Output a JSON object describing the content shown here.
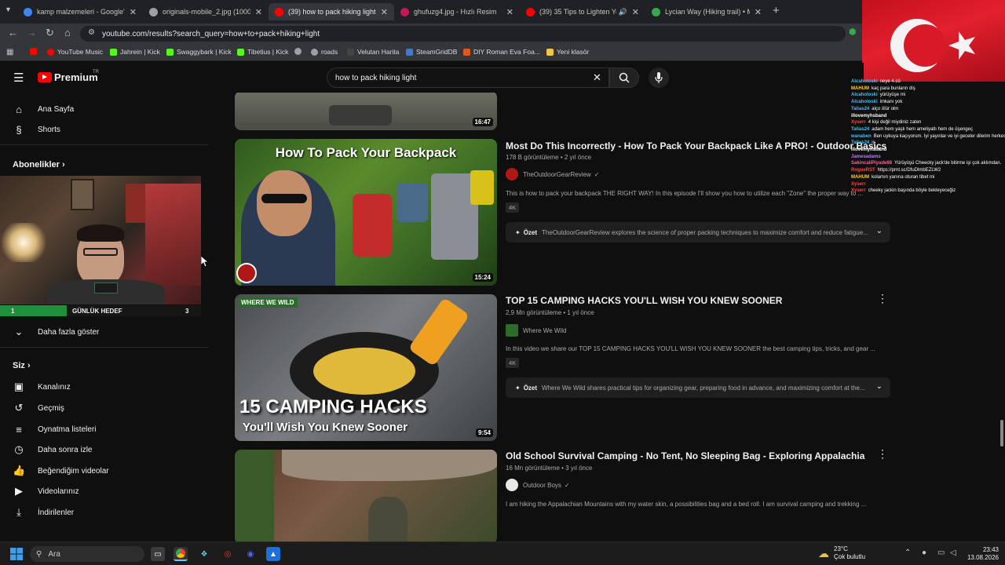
{
  "browser": {
    "tabs": [
      {
        "title": "kamp malzemeleri - Google'da",
        "icon": "google-icon",
        "color": "#4285f4"
      },
      {
        "title": "originals-mobile_2.jpg (1000×1",
        "icon": "globe-icon",
        "color": "#9aa0a6"
      },
      {
        "title": "(39) how to pack hiking light -",
        "icon": "youtube-icon",
        "color": "#ff0000"
      },
      {
        "title": "ghufuzg4.jpg - Hızlı Resim",
        "icon": "image-icon",
        "color": "#c2185b"
      },
      {
        "title": "(39) 35 Tips to Lighten Your",
        "icon": "youtube-icon",
        "color": "#ff0000"
      },
      {
        "title": "Lycian Way (Hiking trail) • Map",
        "icon": "map-icon",
        "color": "#34a853"
      }
    ],
    "url": "youtube.com/results?search_query=how+to+pack+hiking+light",
    "bookmarks": [
      {
        "label": "",
        "color": "#ff0000"
      },
      {
        "label": "YouTube Music",
        "color": "#ff0000"
      },
      {
        "label": "Jahrein | Kick",
        "color": "#53fc18"
      },
      {
        "label": "Swaggybark | Kick",
        "color": "#53fc18"
      },
      {
        "label": "Tibetius | Kick",
        "color": "#53fc18"
      },
      {
        "label": "",
        "color": "#9aa0a6"
      },
      {
        "label": "roads",
        "color": "#9aa0a6"
      },
      {
        "label": "Velutan Harita",
        "color": "#444"
      },
      {
        "label": "SteamGridDB",
        "color": "#3b7bd4"
      },
      {
        "label": "DIY Roman Eva Foa...",
        "color": "#e8551b"
      },
      {
        "label": "Yeni klasör",
        "color": "#f4c542"
      }
    ]
  },
  "youtube": {
    "logo_text": "Premium",
    "logo_sup": "TR",
    "search_value": "how to pack hiking light"
  },
  "sidebar": {
    "top": [
      {
        "label": "Ana Sayfa",
        "icon": "home-icon"
      },
      {
        "label": "Shorts",
        "icon": "shorts-icon"
      }
    ],
    "subs_header": "Abonelikler",
    "goal_left": "1",
    "goal_label": "GÜNLÜK HEDEF",
    "goal_right": "3",
    "show_more": "Daha fazla göster",
    "you_header": "Siz",
    "you_items": [
      {
        "label": "Kanalınız",
        "icon": "channel-icon"
      },
      {
        "label": "Geçmiş",
        "icon": "history-icon"
      },
      {
        "label": "Oynatma listeleri",
        "icon": "playlists-icon"
      },
      {
        "label": "Daha sonra izle",
        "icon": "watch-later-icon"
      },
      {
        "label": "Beğendiğim videolar",
        "icon": "liked-icon"
      },
      {
        "label": "Videolarınız",
        "icon": "your-videos-icon"
      },
      {
        "label": "İndirilenler",
        "icon": "downloads-icon"
      }
    ]
  },
  "results": {
    "prev_duration": "16:47",
    "videos": [
      {
        "title": "Most Do This Incorrectly - How To Pack Your Backpack Like A PRO! - Outdoor Basics",
        "meta": "178 B görüntüleme • 2 yıl önce",
        "channel": "TheOutdoorGearReview",
        "desc": "This is how to pack your backpack THE RIGHT WAY! In this episode I'll show you how to utilize each \"Zone\" the proper way to ...",
        "badge": "4K",
        "summary_label": "Özet",
        "summary": "TheOutdoorGearReview explores the science of proper packing techniques to maximize comfort and reduce fatigue...",
        "duration": "15:24",
        "thumb_text": "How To Pack Your Backpack"
      },
      {
        "title": "TOP 15 CAMPING HACKS YOU'LL WISH YOU KNEW SOONER",
        "meta": "2,9 Mn görüntüleme • 1 yıl önce",
        "channel": "Where We Wild",
        "desc": "In this video we share our TOP 15 CAMPING HACKS YOU'LL WISH YOU KNEW SOONER the best camping tips, tricks, and gear ...",
        "badge": "4K",
        "summary_label": "Özet",
        "summary": "Where We Wild shares practical tips for organizing gear, preparing food in advance, and maximizing comfort at the...",
        "duration": "9:54",
        "thumb_text": "15 CAMPING HACKS",
        "thumb_sub": "You'll Wish You Knew Sooner",
        "thumb_logo": "WHERE WE WILD"
      },
      {
        "title": "Old School Survival Camping - No Tent, No Sleeping Bag - Exploring Appalachia",
        "meta": "16 Mn görüntüleme • 3 yıl önce",
        "channel": "Outdoor Boys",
        "desc": "I am hiking the Appalachian Mountains with my water skin, a possibilities bag and a bed roll. I am survival camping and trekking ..."
      }
    ]
  },
  "chat": [
    {
      "user": "Alcaholoski",
      "msg": "neye 4.cü",
      "color": "#3ec1f4"
    },
    {
      "user": "MAHUM",
      "msg": "kaç para bunların diş",
      "color": "#f4d03e"
    },
    {
      "user": "Alcaholoski",
      "msg": "yürüyüşe mi",
      "color": "#3ec1f4"
    },
    {
      "user": "Alcaholoski",
      "msg": "imkanı yok",
      "color": "#3ec1f4"
    },
    {
      "user": "Talias24",
      "msg": "alço ölür olm",
      "color": "#3ec1f4"
    },
    {
      "user": "illovemyhsband",
      "msg": "",
      "color": "#ffffff"
    },
    {
      "user": "Xyserr",
      "msg": "4 kişi değil miydiniz zaten",
      "color": "#ff4444"
    },
    {
      "user": "Talias24",
      "msg": "adam hem yaşlı hem ameliyatlı hem de üşengeç",
      "color": "#3ec1f4"
    },
    {
      "user": "wanaben",
      "msg": "Ben uykuya kaçıyorum. İyi yayınlar ve iyi geceler dilerim herkese",
      "color": "#3ec1f4"
    },
    {
      "user": "Talias24",
      "msg": "iş",
      "color": "#3ec1f4"
    },
    {
      "user": "illovemyhsband",
      "msg": "",
      "color": "#ffffff"
    },
    {
      "user": "Jamesadams",
      "msg": "",
      "color": "#b57cff"
    },
    {
      "user": "SakincaliPiyade88",
      "msg": "Yürüyüşü Cheecky jack'de bitirme işi çok aklımdan.",
      "color": "#ff5fa0"
    },
    {
      "user": "RogueRST",
      "msg": "https://prnt.sc/DfuDlmbEZLW2",
      "color": "#ff4444"
    },
    {
      "user": "MAHUM",
      "msg": "kolamın yanına oturan tibet mi",
      "color": "#f4d03e"
    },
    {
      "user": "Xyserr",
      "msg": "",
      "color": "#ff4444"
    },
    {
      "user": "Xyserr",
      "msg": "cheeky jackin başında böyle bekleyeceğiz",
      "color": "#ff4444"
    }
  ],
  "taskbar": {
    "search_placeholder": "Ara",
    "weather_temp": "23°C",
    "weather_desc": "Çok bulutlu",
    "time": "23:43",
    "date": "13.08.2026"
  },
  "colors": {
    "accent": "#ff0000",
    "bg": "#0f0f0f"
  }
}
